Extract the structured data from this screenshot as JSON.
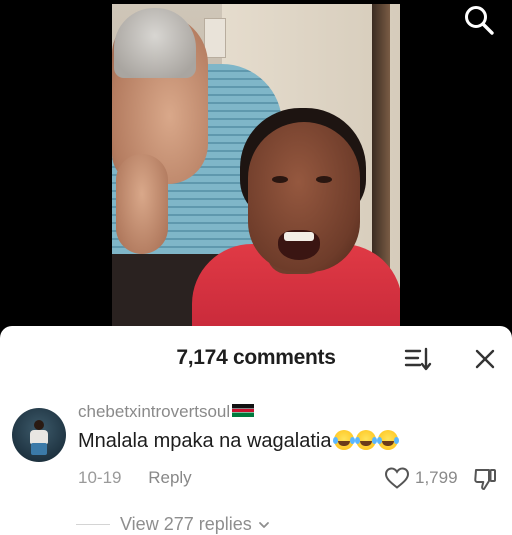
{
  "video": {
    "search_icon": "search-icon"
  },
  "comments_sheet": {
    "title": "7,174 comments",
    "sort_icon": "sort-icon",
    "close_icon": "close-icon"
  },
  "comment": {
    "username": "chebetxintrovertsoul",
    "flag": "kenya-flag",
    "text": "Mnalala mpaka na wagalatia",
    "emoji_count": 3,
    "date": "10-19",
    "reply_label": "Reply",
    "like_count": "1,799",
    "view_replies": "View 277 replies"
  },
  "colors": {
    "sheet_bg": "#ffffff",
    "text_primary": "#1d1d1d",
    "text_secondary": "#8a8a8a"
  }
}
